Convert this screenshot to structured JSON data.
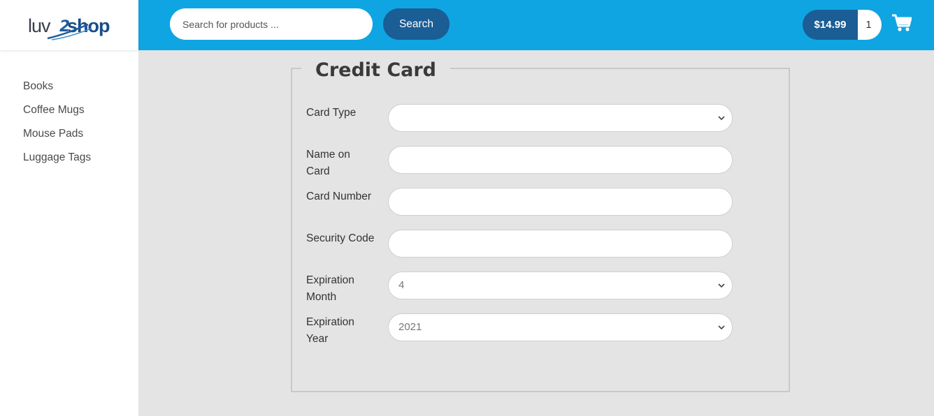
{
  "brand": {
    "logo_left": "luv",
    "logo_mid": "2",
    "logo_right": "shop"
  },
  "sidebar": {
    "items": [
      {
        "label": "Books"
      },
      {
        "label": "Coffee Mugs"
      },
      {
        "label": "Mouse Pads"
      },
      {
        "label": "Luggage Tags"
      }
    ]
  },
  "header": {
    "search_placeholder": "Search for products ...",
    "search_button": "Search",
    "cart_total": "$14.99",
    "cart_quantity": "1",
    "cart_icon": "shopping-cart-icon"
  },
  "form": {
    "legend": "Credit Card",
    "fields": [
      {
        "label": "Card Type",
        "type": "select",
        "value": ""
      },
      {
        "label": "Name on Card",
        "type": "input",
        "value": ""
      },
      {
        "label": "Card Number",
        "type": "input",
        "value": ""
      },
      {
        "label": "Security Code",
        "type": "input",
        "value": ""
      },
      {
        "label": "Expiration Month",
        "type": "select",
        "value": "4"
      },
      {
        "label": "Expiration Year",
        "type": "select",
        "value": "2021"
      }
    ]
  },
  "colors": {
    "header_bg": "#0fa5e3",
    "button_bg": "#1b5d95",
    "page_bg": "#e4e4e4"
  }
}
